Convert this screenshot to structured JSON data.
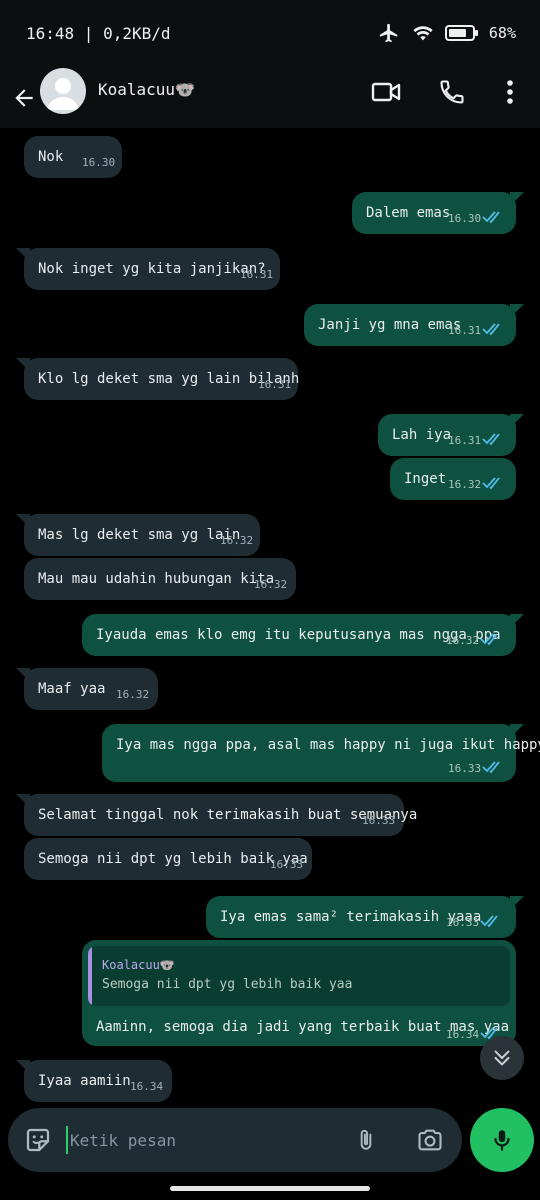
{
  "status": {
    "time": "16:48 | 0,2KB/d",
    "battery": "68%"
  },
  "contact": {
    "name": "Koalacuu🐨"
  },
  "icons": {
    "back": "arrow-left-icon",
    "avatar": "default-avatar-icon",
    "video": "video-call-icon",
    "call": "phone-icon",
    "menu": "more-vertical-icon",
    "ticks": "double-check-icon",
    "sticker": "sticker-icon",
    "attach": "paperclip-icon",
    "camera": "camera-icon",
    "mic": "microphone-icon",
    "scroll": "chevrons-down-icon"
  },
  "colors": {
    "incoming": "#1f2c34",
    "outgoing": "#0f5141",
    "accent": "#21c063",
    "read_ticks": "#53bdeb"
  },
  "messages": [
    {
      "dir": "in",
      "text": "Nok",
      "time": "16.30"
    },
    {
      "dir": "out",
      "text": "Dalem emas",
      "time": "16.30"
    },
    {
      "dir": "in",
      "text": "Nok inget yg kita janjikan?",
      "time": "16.31"
    },
    {
      "dir": "out",
      "text": "Janji yg mna emas",
      "time": "16.31"
    },
    {
      "dir": "in",
      "text": "Klo lg deket sma yg lain bilanh",
      "time": "16.31"
    },
    {
      "dir": "out",
      "text": "Lah iya",
      "time": "16.31"
    },
    {
      "dir": "out",
      "text": "Inget",
      "time": "16.32"
    },
    {
      "dir": "in",
      "text": "Mas lg deket sma yg lain",
      "time": "16.32"
    },
    {
      "dir": "in",
      "text": "Mau mau udahin hubungan kita",
      "time": "16.32"
    },
    {
      "dir": "out",
      "text": "Iyauda emas klo emg itu keputusanya mas ngga ppa",
      "time": "16.32"
    },
    {
      "dir": "in",
      "text": "Maaf yaa",
      "time": "16.32"
    },
    {
      "dir": "out",
      "text": "Iya mas ngga ppa, asal mas happy ni juga ikut happy kok",
      "time": "16.33"
    },
    {
      "dir": "in",
      "text": "Selamat tinggal nok terimakasih buat semuanya",
      "time": "16.33"
    },
    {
      "dir": "in",
      "text": "Semoga nii dpt yg lebih baik yaa",
      "time": "16.33"
    },
    {
      "dir": "out",
      "text": "Iya emas sama² terimakasih yaaa",
      "time": "16.33"
    },
    {
      "dir": "out",
      "text": "Aaminn, semoga dia jadi yang terbaik buat mas yaa",
      "time": "16.34",
      "reply": {
        "name": "Koalacuu🐨",
        "text": "Semoga nii dpt yg lebih baik yaa"
      }
    },
    {
      "dir": "in",
      "text": "Iyaa aamiin",
      "time": "16.34"
    }
  ],
  "composer": {
    "placeholder": "Ketik pesan"
  }
}
